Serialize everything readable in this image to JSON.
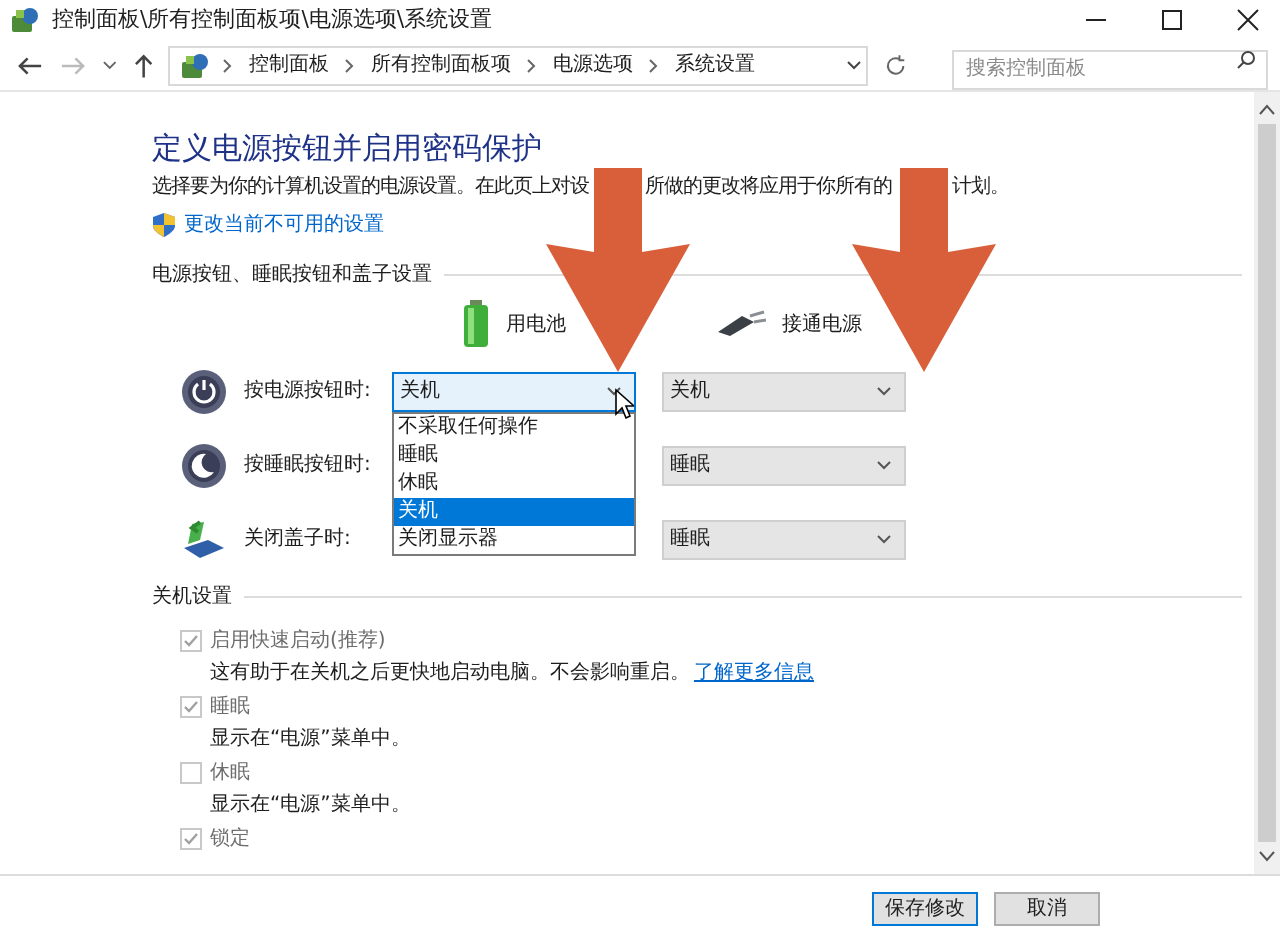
{
  "window": {
    "title": "控制面板\\所有控制面板项\\电源选项\\系统设置"
  },
  "breadcrumb": [
    "控制面板",
    "所有控制面板项",
    "电源选项",
    "系统设置"
  ],
  "search": {
    "placeholder": "搜索控制面板"
  },
  "heading": "定义电源按钮并启用密码保护",
  "description": [
    "选择要为你的计算机设置的电源设置。在此页上对设",
    "所做的更改将应用于你所有的",
    "计划。"
  ],
  "admin_link": "更改当前不可用的设置",
  "power_section": {
    "title": "电源按钮、睡眠按钮和盖子设置",
    "columns": [
      {
        "kind": "battery",
        "label": "用电池"
      },
      {
        "kind": "plug",
        "label": "接通电源"
      }
    ],
    "rows": [
      {
        "kind": "power",
        "label": "按电源按钮时:",
        "battery": "关机",
        "plugged": "关机",
        "open": true,
        "options": [
          {
            "label": "不采取任何操作",
            "selected": false
          },
          {
            "label": "睡眠",
            "selected": false
          },
          {
            "label": "休眠",
            "selected": false
          },
          {
            "label": "关机",
            "selected": true
          },
          {
            "label": "关闭显示器",
            "selected": false
          }
        ]
      },
      {
        "kind": "sleep",
        "label": "按睡眠按钮时:",
        "plugged": "睡眠"
      },
      {
        "kind": "lid",
        "label": "关闭盖子时:",
        "plugged": "睡眠"
      }
    ]
  },
  "shutdown_section": {
    "title": "关机设置",
    "items": [
      {
        "label": "启用快速启动(推荐)",
        "checked": true,
        "description": "这有助于在关机之后更快地启动电脑。不会影响重启。",
        "link": "了解更多信息"
      },
      {
        "label": "睡眠",
        "checked": true,
        "description": "显示在“电源”菜单中。"
      },
      {
        "label": "休眠",
        "checked": false,
        "description": "显示在“电源”菜单中。"
      },
      {
        "label": "锁定",
        "checked": true
      }
    ]
  },
  "buttons": [
    {
      "kind": "primary",
      "label": "保存修改"
    },
    {
      "kind": "normal",
      "label": "取消"
    }
  ]
}
